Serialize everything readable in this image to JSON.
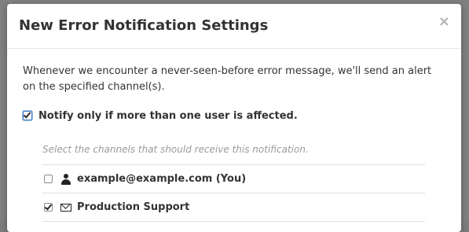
{
  "modal": {
    "title": "New Error Notification Settings",
    "close_symbol": "×",
    "intro_text": "Whenever we encounter a never-seen-before error message, we'll send an alert on the specified channel(s).",
    "notify_label": "Notify only if more than one user is affected.",
    "notify_checked": true,
    "channels_hint": "Select the channels that should receive this notification.",
    "channels": [
      {
        "label": "example@example.com (You)",
        "icon": "user-icon",
        "checked": false
      },
      {
        "label": "Production Support",
        "icon": "envelope-icon",
        "checked": true
      }
    ]
  },
  "colors": {
    "overlay": "#808080",
    "checkbox_accent": "#3b76c4"
  }
}
